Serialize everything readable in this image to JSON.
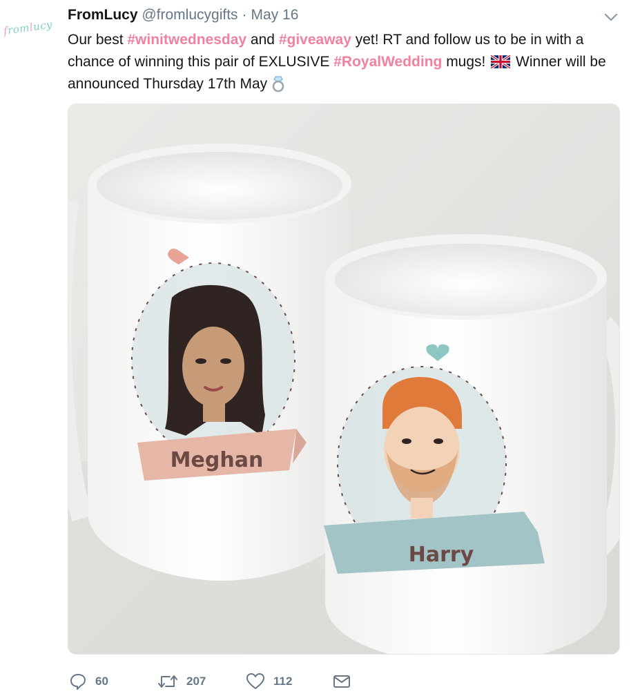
{
  "tweet": {
    "author_name": "FromLucy",
    "author_handle": "@fromlucygifts",
    "separator": "·",
    "date": "May 16",
    "avatar_logo_text": "fromlucy",
    "text_parts": {
      "p1": "Our best ",
      "tag1": "#winitwednesday",
      "p2": " and ",
      "tag2": "#giveaway",
      "p3": " yet! RT and follow us to be in with a chance of winning this pair of EXLUSIVE ",
      "tag3": "#RoyalWedding",
      "p4": " mugs! ",
      "p5": " Winner will be announced Thursday 17th May "
    },
    "media": {
      "left_mug_name": "Meghan",
      "right_mug_name": "Harry"
    },
    "actions": {
      "reply_count": "60",
      "retweet_count": "207",
      "like_count": "112"
    },
    "icons": {
      "caret": "chevron-down-icon",
      "reply": "reply-icon",
      "retweet": "retweet-icon",
      "like": "heart-icon",
      "dm": "envelope-icon",
      "flag": "uk-flag-emoji",
      "ring": "ring-emoji"
    },
    "colors": {
      "hashtag": "#f0819f",
      "muted": "#657786",
      "text": "#14171a"
    }
  }
}
